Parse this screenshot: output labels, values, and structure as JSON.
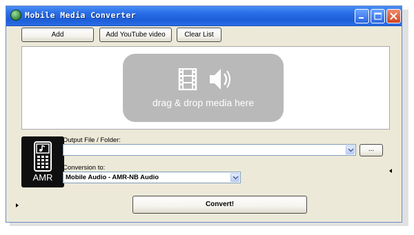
{
  "window": {
    "title": "Mobile Media Converter"
  },
  "toolbar": {
    "add_label": "Add",
    "add_youtube_label": "Add YouTube video",
    "clear_list_label": "Clear List"
  },
  "dropzone": {
    "text": "drag & drop media here"
  },
  "format": {
    "badge": "AMR"
  },
  "output": {
    "label": "Output File / Folder:",
    "value": "",
    "browse_label": "..."
  },
  "conversion": {
    "label": "Conversion to:",
    "selected": "Mobile Audio - AMR-NB Audio"
  },
  "actions": {
    "convert_label": "Convert!"
  },
  "icons": {
    "app": "app-icon",
    "minimize": "minimize-icon",
    "maximize": "maximize-icon",
    "close": "close-icon",
    "film": "film-strip-icon",
    "speaker": "speaker-icon",
    "phone": "mobile-phone-icon",
    "expand_right": "expand-arrow-icon",
    "expand_left": "collapse-arrow-icon"
  },
  "colors": {
    "titlebar": "#1d5fd8",
    "window_bg": "#ece9d8",
    "dropzone_box": "#b9b9b9",
    "format_icon_bg": "#0f0f0f"
  }
}
